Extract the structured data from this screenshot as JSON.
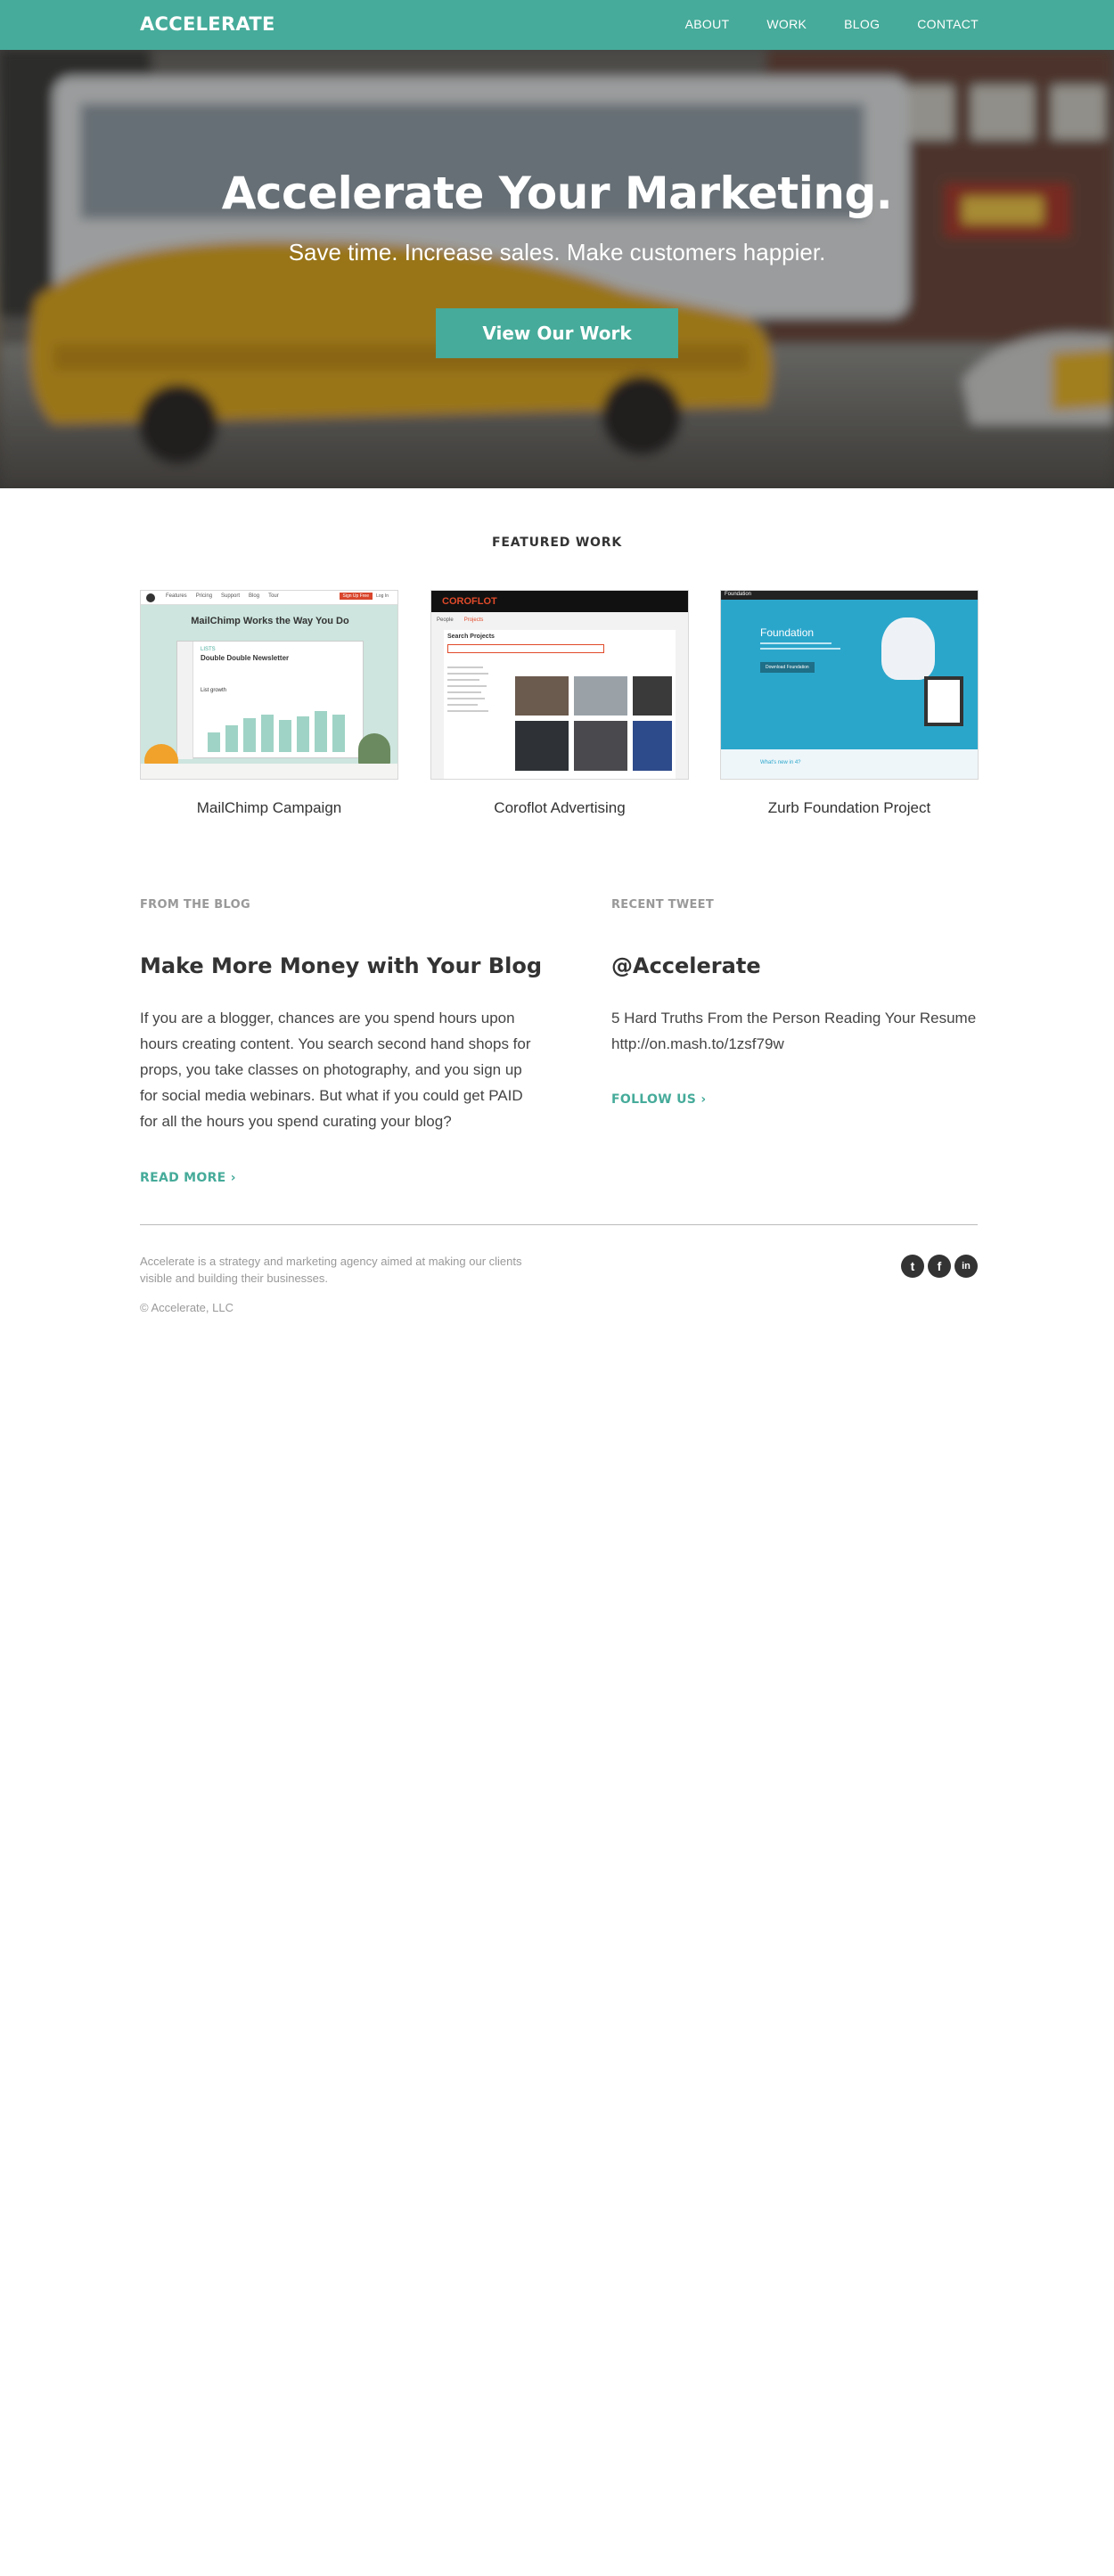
{
  "nav": {
    "logo": "ACCELERATE",
    "links": [
      "ABOUT",
      "WORK",
      "BLOG",
      "CONTACT"
    ]
  },
  "hero": {
    "title": "Accelerate Your Marketing.",
    "subtitle": "Save time. Increase sales. Make customers happier.",
    "cta": "View Our Work"
  },
  "featured": {
    "title": "FEATURED WORK",
    "items": [
      {
        "caption": "MailChimp Campaign",
        "thumb": {
          "headline": "MailChimp Works the Way You Do",
          "signup_button": "Sign Up Free",
          "login": "Log In",
          "nav": [
            "Features",
            "Pricing",
            "Support",
            "Blog",
            "Tour"
          ],
          "list_label": "LISTS",
          "newsletter": "Double Double Newsletter",
          "growth": "List growth"
        }
      },
      {
        "caption": "Coroflot Advertising",
        "thumb": {
          "logo": "COROFLOT",
          "heading": "Search Projects",
          "tabs": [
            "People",
            "Projects"
          ]
        }
      },
      {
        "caption": "Zurb Foundation Project",
        "thumb": {
          "brand": "Foundation",
          "title": "Foundation",
          "button": "Download Foundation",
          "footer": "What's new in 4?"
        }
      }
    ]
  },
  "blog": {
    "label": "FROM THE BLOG",
    "heading": "Make More Money with Your Blog",
    "body": "If you are a blogger, chances are you spend hours upon hours creating content. You search second hand shops for props, you take classes on photography, and you sign up for social media webinars. But what if you could get PAID for all the hours you spend curating your blog?",
    "read_more": "READ MORE ›"
  },
  "tweet": {
    "label": "RECENT TWEET",
    "handle": "@Accelerate",
    "body": "5 Hard Truths From the Person Reading Your Resume http://on.mash.to/1zsf79w",
    "follow": "FOLLOW US  ›"
  },
  "footer": {
    "about": "Accelerate is a strategy and marketing agency aimed at making our clients visible and building their businesses.",
    "copyright": "© Accelerate, LLC",
    "social": [
      {
        "icon": "twitter-icon",
        "glyph": "t"
      },
      {
        "icon": "facebook-icon",
        "glyph": "f"
      },
      {
        "icon": "linkedin-icon",
        "glyph": "in"
      }
    ]
  },
  "colors": {
    "accent": "#46ab9a",
    "text": "#333333",
    "muted": "#999999"
  }
}
